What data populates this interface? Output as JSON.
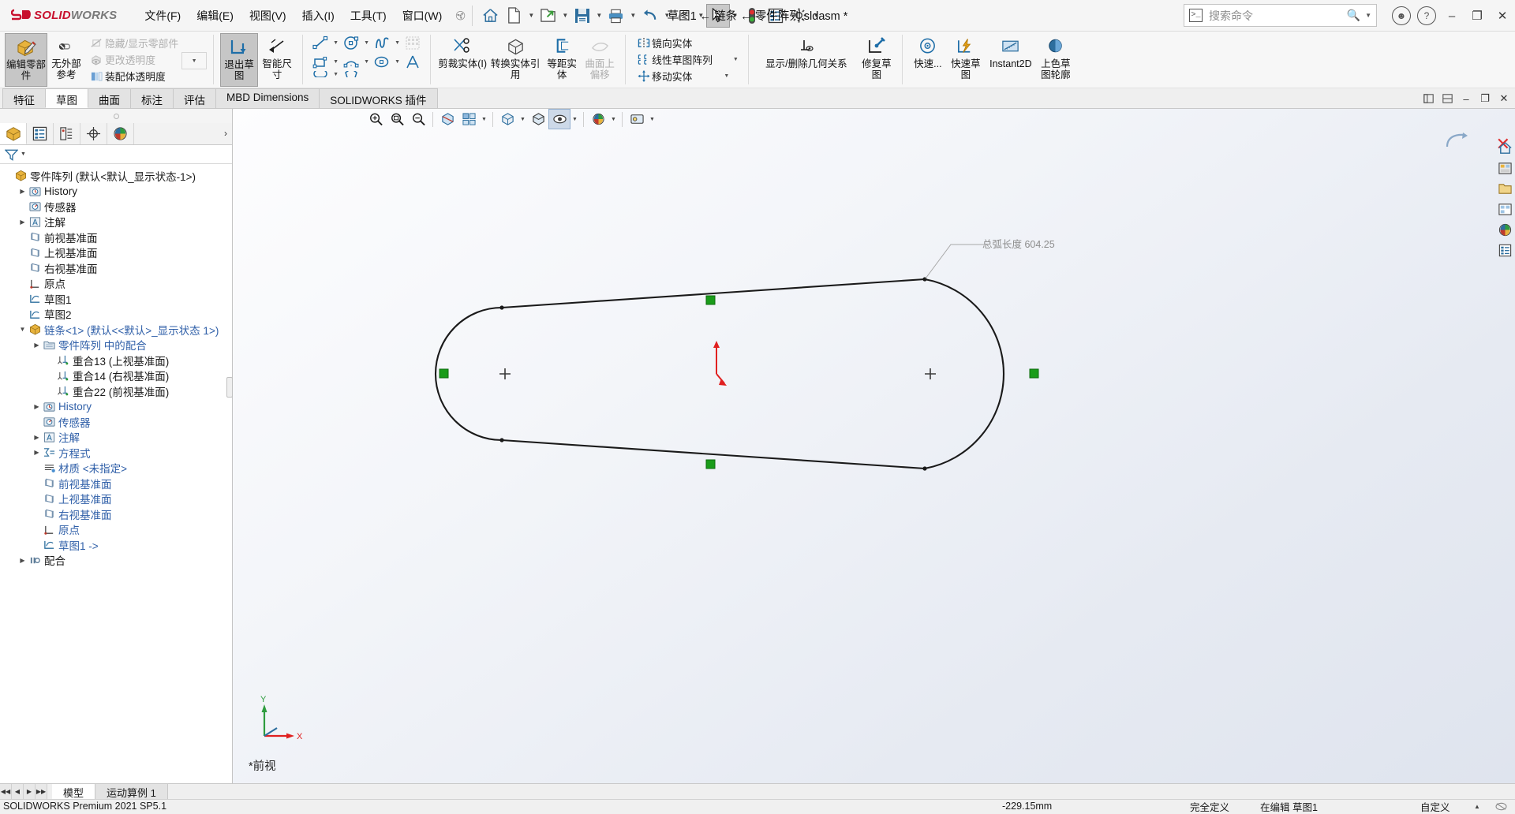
{
  "app": {
    "logo_ds": "2S",
    "logo_solid": "SOLID",
    "logo_works": "WORKS",
    "document_title": "草图1 ← 链条 ← 零件阵列.sldasm *"
  },
  "menubar": {
    "items": [
      {
        "label": "文件(F)",
        "name": "menu-file"
      },
      {
        "label": "编辑(E)",
        "name": "menu-edit"
      },
      {
        "label": "视图(V)",
        "name": "menu-view"
      },
      {
        "label": "插入(I)",
        "name": "menu-insert"
      },
      {
        "label": "工具(T)",
        "name": "menu-tools"
      },
      {
        "label": "窗口(W)",
        "name": "menu-window"
      }
    ]
  },
  "quickaccess": {
    "items": [
      {
        "name": "home-icon",
        "icon": "home"
      },
      {
        "name": "new-document-icon",
        "icon": "new"
      },
      {
        "name": "open-document-icon",
        "icon": "open"
      },
      {
        "name": "save-icon",
        "icon": "save"
      },
      {
        "name": "print-icon",
        "icon": "print"
      },
      {
        "name": "undo-icon",
        "icon": "undo"
      },
      {
        "name": "redo-icon",
        "icon": "redo"
      },
      {
        "name": "select-icon",
        "icon": "select"
      },
      {
        "name": "rebuild-icon",
        "icon": "traffic"
      },
      {
        "name": "file-properties-icon",
        "icon": "props"
      },
      {
        "name": "options-icon",
        "icon": "gear"
      }
    ]
  },
  "search": {
    "placeholder": "搜索命令",
    "name": "command-search"
  },
  "window_controls": {
    "account": "account-icon",
    "help": "help-icon",
    "minimize": "–",
    "maximize": "❐",
    "close": "✕"
  },
  "ribbon": {
    "assembly_group": {
      "edit_component": "编辑零部件",
      "no_external_refs": "无外部参考",
      "hide_show_components": "隐藏/显示零部件",
      "change_transparency": "更改透明度",
      "assembly_transparency": "装配体透明度"
    },
    "exit_sketch": "退出草图",
    "smart_dimension": "智能尺寸",
    "sketch_tools": [
      {
        "name": "line-tool",
        "icon": "line"
      },
      {
        "name": "circle-tool",
        "icon": "circle"
      },
      {
        "name": "spline-tool",
        "icon": "spline"
      },
      {
        "name": "pattern-tool",
        "icon": "grid"
      },
      {
        "name": "rectangle-tool",
        "icon": "rect"
      },
      {
        "name": "arc-tool",
        "icon": "arc"
      },
      {
        "name": "ellipse-tool",
        "icon": "ellipse"
      },
      {
        "name": "text-tool",
        "icon": "text"
      }
    ],
    "trim_entities": "剪裁实体(I)",
    "convert_entities": "转换实体引用",
    "offset_entities": "等距实体",
    "offset_on_surface": "曲面上偏移",
    "mirror_entities": "镜向实体",
    "linear_sketch_pattern": "线性草图阵列",
    "move_entities": "移动实体",
    "display_delete_relations": "显示/删除几何关系",
    "repair_sketch": "修复草图",
    "quick_snaps": "快速...",
    "quick_sketch": "快速草图",
    "instant2d": "Instant2D",
    "shaded_sketch_contours": "上色草图轮廓"
  },
  "command_tabs": {
    "items": [
      {
        "label": "特征",
        "name": "tab-features",
        "active": false
      },
      {
        "label": "草图",
        "name": "tab-sketch",
        "active": true
      },
      {
        "label": "曲面",
        "name": "tab-surfaces",
        "active": false
      },
      {
        "label": "标注",
        "name": "tab-markup",
        "active": false
      },
      {
        "label": "评估",
        "name": "tab-evaluate",
        "active": false
      },
      {
        "label": "MBD Dimensions",
        "name": "tab-mbd-dimensions",
        "active": false
      },
      {
        "label": "SOLIDWORKS 插件",
        "name": "tab-solidworks-addins",
        "active": false
      }
    ]
  },
  "panel_tabs": [
    {
      "name": "feature-manager-tab",
      "icon": "tree",
      "active": true
    },
    {
      "name": "property-manager-tab",
      "icon": "list",
      "active": false
    },
    {
      "name": "configuration-manager-tab",
      "icon": "config",
      "active": false
    },
    {
      "name": "dimxpert-manager-tab",
      "icon": "dimxpert",
      "active": false
    },
    {
      "name": "display-manager-tab",
      "icon": "appearance",
      "active": false
    }
  ],
  "filter": {
    "name": "tree-filter",
    "icon": "funnel-icon"
  },
  "tree": {
    "root": "零件阵列  (默认<默认_显示状态-1>)",
    "nodes": [
      {
        "label": "零件阵列  (默认<默认_显示状态-1>)",
        "indent": 0,
        "twisty": "",
        "icon": "assembly",
        "style": "",
        "name": "tree-node-assembly-root"
      },
      {
        "label": "History",
        "indent": 1,
        "twisty": "▶",
        "icon": "history",
        "style": "",
        "name": "tree-node-history"
      },
      {
        "label": "传感器",
        "indent": 1,
        "twisty": "",
        "icon": "sensor",
        "style": "",
        "name": "tree-node-sensors"
      },
      {
        "label": "注解",
        "indent": 1,
        "twisty": "▶",
        "icon": "annotation",
        "style": "",
        "name": "tree-node-annotations"
      },
      {
        "label": "前视基准面",
        "indent": 1,
        "twisty": "",
        "icon": "plane",
        "style": "",
        "name": "tree-node-front-plane"
      },
      {
        "label": "上视基准面",
        "indent": 1,
        "twisty": "",
        "icon": "plane",
        "style": "",
        "name": "tree-node-top-plane"
      },
      {
        "label": "右视基准面",
        "indent": 1,
        "twisty": "",
        "icon": "plane",
        "style": "",
        "name": "tree-node-right-plane"
      },
      {
        "label": "原点",
        "indent": 1,
        "twisty": "",
        "icon": "origin",
        "style": "",
        "name": "tree-node-origin"
      },
      {
        "label": "草图1",
        "indent": 1,
        "twisty": "",
        "icon": "sketch",
        "style": "",
        "name": "tree-node-sketch1"
      },
      {
        "label": "草图2",
        "indent": 1,
        "twisty": "",
        "icon": "sketch",
        "style": "",
        "name": "tree-node-sketch2"
      },
      {
        "label": "链条<1>  (默认<<默认>_显示状态 1>)",
        "indent": 1,
        "twisty": "▼",
        "icon": "part",
        "style": "blue",
        "name": "tree-node-chain-component"
      },
      {
        "label": "零件阵列 中的配合",
        "indent": 2,
        "twisty": "▶",
        "icon": "folder",
        "style": "blue",
        "name": "tree-node-mates-folder"
      },
      {
        "label": "重合13 (上视基准面)",
        "indent": 3,
        "twisty": "",
        "icon": "mate",
        "style": "",
        "name": "tree-node-mate-13"
      },
      {
        "label": "重合14 (右视基准面)",
        "indent": 3,
        "twisty": "",
        "icon": "mate",
        "style": "",
        "name": "tree-node-mate-14"
      },
      {
        "label": "重合22 (前视基准面)",
        "indent": 3,
        "twisty": "",
        "icon": "mate",
        "style": "",
        "name": "tree-node-mate-22"
      },
      {
        "label": "History",
        "indent": 2,
        "twisty": "▶",
        "icon": "history",
        "style": "blue",
        "name": "tree-node-sub-history"
      },
      {
        "label": "传感器",
        "indent": 2,
        "twisty": "",
        "icon": "sensor",
        "style": "blue",
        "name": "tree-node-sub-sensors"
      },
      {
        "label": "注解",
        "indent": 2,
        "twisty": "▶",
        "icon": "annotation",
        "style": "blue",
        "name": "tree-node-sub-annotations"
      },
      {
        "label": "方程式",
        "indent": 2,
        "twisty": "▶",
        "icon": "equation",
        "style": "blue",
        "name": "tree-node-equations"
      },
      {
        "label": "材质 <未指定>",
        "indent": 2,
        "twisty": "",
        "icon": "material",
        "style": "blue",
        "name": "tree-node-material"
      },
      {
        "label": "前视基准面",
        "indent": 2,
        "twisty": "",
        "icon": "plane",
        "style": "blue",
        "name": "tree-node-sub-front-plane"
      },
      {
        "label": "上视基准面",
        "indent": 2,
        "twisty": "",
        "icon": "plane",
        "style": "blue",
        "name": "tree-node-sub-top-plane"
      },
      {
        "label": "右视基准面",
        "indent": 2,
        "twisty": "",
        "icon": "plane",
        "style": "blue",
        "name": "tree-node-sub-right-plane"
      },
      {
        "label": "原点",
        "indent": 2,
        "twisty": "",
        "icon": "origin",
        "style": "blue",
        "name": "tree-node-sub-origin"
      },
      {
        "label": "草图1 ->",
        "indent": 2,
        "twisty": "",
        "icon": "sketch",
        "style": "blue",
        "name": "tree-node-sub-sketch1"
      },
      {
        "label": "配合",
        "indent": 1,
        "twisty": "▶",
        "icon": "mates",
        "style": "",
        "name": "tree-node-mates"
      }
    ]
  },
  "viewport_toolbar": [
    {
      "name": "zoom-to-fit-icon",
      "icon": "zoomfit"
    },
    {
      "name": "zoom-to-area-icon",
      "icon": "zoomarea"
    },
    {
      "name": "previous-view-icon",
      "icon": "prevview"
    },
    {
      "name": "section-view-icon",
      "icon": "section"
    },
    {
      "name": "view-orientation-icon",
      "icon": "vieworient"
    },
    {
      "name": "display-style-icon",
      "icon": "displaystyle"
    },
    {
      "name": "hide-show-items-icon",
      "icon": "hideshow"
    },
    {
      "name": "apply-scene-icon",
      "icon": "scene"
    },
    {
      "name": "view-settings-icon",
      "icon": "viewsettings"
    }
  ],
  "right_dock": [
    {
      "name": "dock-home-icon",
      "icon": "home"
    },
    {
      "name": "dock-design-library-icon",
      "icon": "library"
    },
    {
      "name": "dock-file-explorer-icon",
      "icon": "explorer"
    },
    {
      "name": "dock-view-palette-icon",
      "icon": "palette"
    },
    {
      "name": "dock-appearances-icon",
      "icon": "appearance"
    },
    {
      "name": "dock-custom-properties-icon",
      "icon": "props"
    }
  ],
  "graphics": {
    "view_label": "*前视",
    "dimension_label": "总弧长度 604.25",
    "triad_x": "X",
    "triad_y": "Y"
  },
  "doc_tabs": [
    {
      "label": "模型",
      "name": "doc-tab-model",
      "active": true
    },
    {
      "label": "运动算例 1",
      "name": "doc-tab-motion-study",
      "active": false
    }
  ],
  "statusbar": {
    "product": "SOLIDWORKS Premium 2021 SP5.1",
    "coordinate": "-229.15mm",
    "definition_state": "完全定义",
    "editing_state": "在编辑 草图1",
    "custom": "自定义"
  },
  "colors": {
    "brand_red": "#c8102e",
    "accent_blue": "#2f5fa8",
    "sketch_green": "#1a9c1a",
    "origin_red": "#e02020"
  },
  "chart_data": null
}
